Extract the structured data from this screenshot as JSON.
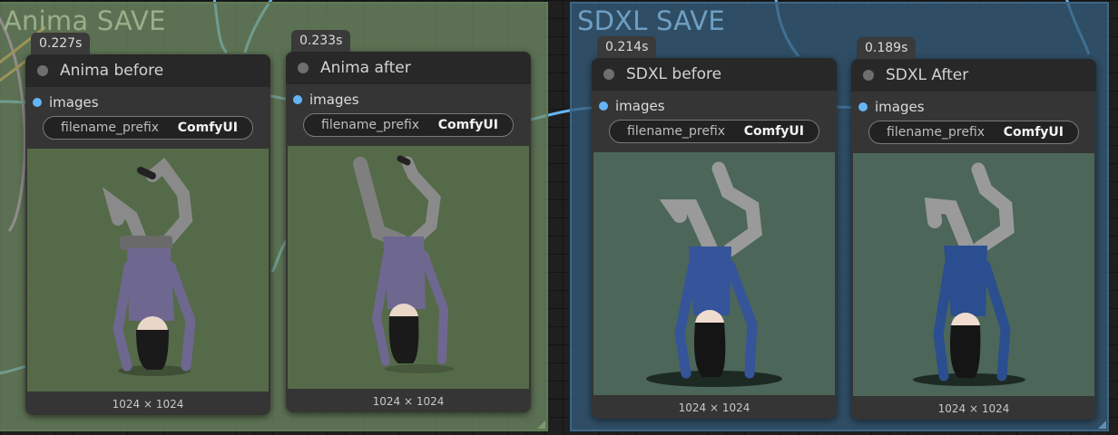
{
  "groups": {
    "anima": {
      "title": "Anima SAVE"
    },
    "sdxl": {
      "title": "SDXL SAVE"
    }
  },
  "nodes": [
    {
      "id": "anima_before",
      "title": "Anima before",
      "timing": "0.227s",
      "input_label": "images",
      "widget": {
        "name": "filename_prefix",
        "value": "ComfyUI"
      },
      "dimensions": "1024 × 1024",
      "preview_bg": "#556a48",
      "preview_style": "green"
    },
    {
      "id": "anima_after",
      "title": "Anima after",
      "timing": "0.233s",
      "input_label": "images",
      "widget": {
        "name": "filename_prefix",
        "value": "ComfyUI"
      },
      "dimensions": "1024 × 1024",
      "preview_bg": "#556a48",
      "preview_style": "green"
    },
    {
      "id": "sdxl_before",
      "title": "SDXL before",
      "timing": "0.214s",
      "input_label": "images",
      "widget": {
        "name": "filename_prefix",
        "value": "ComfyUI"
      },
      "dimensions": "1024 × 1024",
      "preview_bg": "#4c6659",
      "preview_style": "blue"
    },
    {
      "id": "sdxl_after",
      "title": "SDXL After",
      "timing": "0.189s",
      "input_label": "images",
      "widget": {
        "name": "filename_prefix",
        "value": "ComfyUI"
      },
      "dimensions": "1024 × 1024",
      "preview_bg": "#4c6659",
      "preview_style": "blue"
    }
  ],
  "colors": {
    "wire_image": "#64b5f6",
    "wire_pink": "#e07ff0",
    "wire_orange": "#ff9a2e",
    "anima_group": "#749268",
    "sdxl_group": "#355b78"
  }
}
